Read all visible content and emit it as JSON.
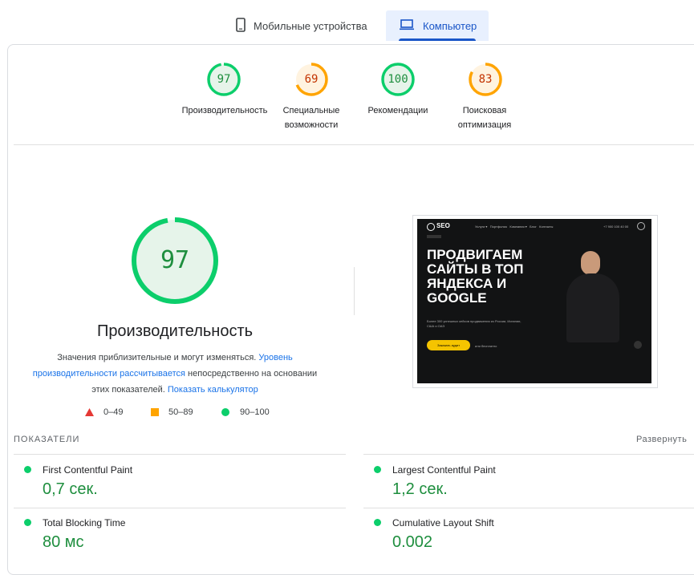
{
  "tabs": [
    {
      "label": "Мобильные устройства",
      "icon": "phone-icon"
    },
    {
      "label": "Компьютер",
      "icon": "laptop-icon"
    }
  ],
  "categories": [
    {
      "score": "97",
      "label_line1": "Производительность",
      "label_line2": "",
      "value": 0.97,
      "color": "#0cce6b",
      "text_color": "#1e8e3e",
      "bg": "#e6f4ea"
    },
    {
      "score": "69",
      "label_line1": "Специальные",
      "label_line2": "возможности",
      "value": 0.69,
      "color": "#ffa400",
      "text_color": "#c33300",
      "bg": "#fff3e0"
    },
    {
      "score": "100",
      "label_line1": "Рекомендации",
      "label_line2": "",
      "value": 1.0,
      "color": "#0cce6b",
      "text_color": "#1e8e3e",
      "bg": "#e6f4ea"
    },
    {
      "score": "83",
      "label_line1": "Поисковая",
      "label_line2": "оптимизация",
      "value": 0.83,
      "color": "#ffa400",
      "text_color": "#c33300",
      "bg": "#fff3e0"
    }
  ],
  "main": {
    "score": "97",
    "value": 0.97,
    "title": "Производительность",
    "desc_1": "Значения приблизительные и могут изменяться.",
    "link_1": "Уровень производительности рассчитывается",
    "desc_2": "непосредственно на основании этих показателей.",
    "link_2": "Показать калькулятор"
  },
  "legend": [
    {
      "range": "0–49",
      "shape": "triangle",
      "color": "#ff4e42"
    },
    {
      "range": "50–89",
      "shape": "square",
      "color": "#ffa400"
    },
    {
      "range": "90–100",
      "shape": "circle",
      "color": "#0cce6b"
    }
  ],
  "screenshot": {
    "logo": "SEO",
    "nav": "Услуги ▾   Портфолио   Компания ▾   Блог   Контакты",
    "phone": "+7 900 100 40 00",
    "headline": [
      "ПРОДВИГАЕМ",
      "САЙТЫ В ТОП",
      "ЯНДЕКСА И",
      "GOOGLE"
    ],
    "sub": "Более 300 успешных кейсов продвижения из России, Испании, США и ОАЭ",
    "cta": "Заказать аудит",
    "cta2": "или бесплатно"
  },
  "metrics": {
    "header": "ПОКАЗАТЕЛИ",
    "expand": "Развернуть",
    "items": [
      {
        "name": "First Contentful Paint",
        "value": "0,7 сек."
      },
      {
        "name": "Largest Contentful Paint",
        "value": "1,2 сек."
      },
      {
        "name": "Total Blocking Time",
        "value": "80 мс"
      },
      {
        "name": "Cumulative Layout Shift",
        "value": "0.002"
      }
    ]
  }
}
